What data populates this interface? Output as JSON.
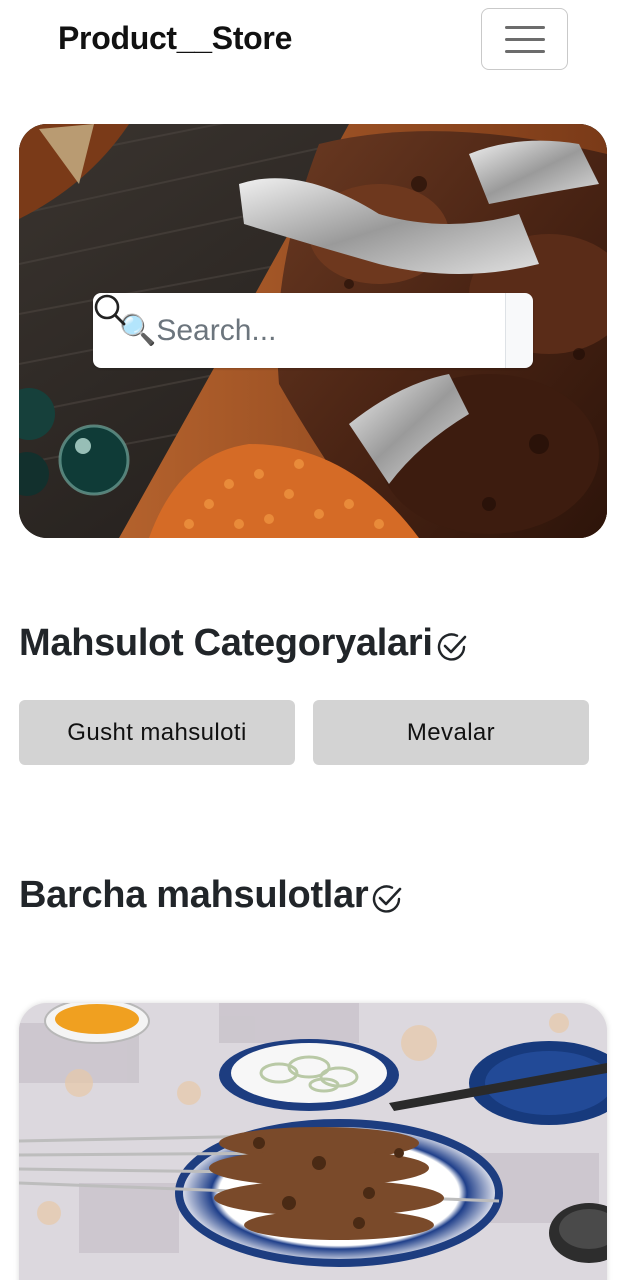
{
  "navbar": {
    "brand": "Product__Store",
    "toggler_icon": "hamburger-menu-icon"
  },
  "hero": {
    "image": "grilled-meat-with-rice-photo",
    "search": {
      "placeholder": "🔍Search...",
      "button_icon": "search-icon"
    }
  },
  "categories": {
    "title": "Mahsulot Categoryalari",
    "title_icon": "check-circle-icon",
    "items": [
      {
        "label": "Gusht mahsuloti"
      },
      {
        "label": "Mevalar"
      }
    ]
  },
  "products": {
    "title": "Barcha mahsulotlar",
    "title_icon": "check-circle-icon",
    "items": [
      {
        "image": "shashlik-skewers-on-plate-photo"
      }
    ]
  },
  "colors": {
    "category_button_bg": "#d3d3d3",
    "text": "#212529",
    "search_button_bg": "#f8f9fa"
  }
}
